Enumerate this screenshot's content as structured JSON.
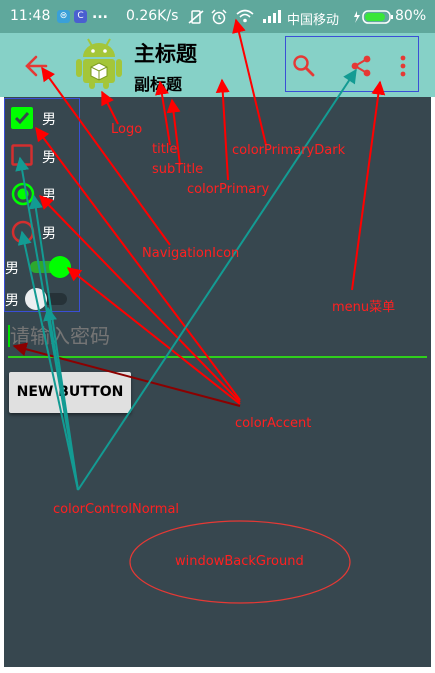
{
  "status_bar": {
    "time": "11:48",
    "overflow_dots": "...",
    "net_speed": "0.26K/s",
    "carrier": "中国移动",
    "battery": "80%"
  },
  "toolbar": {
    "title": "主标题",
    "subtitle": "副标题"
  },
  "widgets": {
    "checkbox_checked_label": "男",
    "checkbox_unchecked_label": "男",
    "radio_checked_label": "男",
    "radio_unchecked_label": "男",
    "switch_on_label": "男",
    "switch_off_label": "男",
    "checkbox_checked": true,
    "checkbox_unchecked": false,
    "radio_checked": true,
    "radio_unchecked": false,
    "switch_on": true,
    "switch_off": false
  },
  "edit_text": {
    "placeholder": "请输入密码",
    "value": ""
  },
  "button": {
    "label": "NEW BUTTON"
  },
  "annotations": {
    "logo": "Logo",
    "title": "title",
    "subtitle": "subTitle",
    "color_primary": "colorPrimary",
    "color_primary_dark": "colorPrimaryDark",
    "navigation_icon": "NavigationIcon",
    "menu": "menu菜单",
    "color_accent": "colorAccent",
    "color_control_normal": "colorControlNormal",
    "window_background": "windowBackGround"
  },
  "colors": {
    "color_primary": "#86d1c7",
    "color_primary_dark": "#5fa89c",
    "color_accent": "#00ff00",
    "color_control_normal": "#d32f2f",
    "window_background": "#37474f",
    "menu_icon": "#e53935",
    "annotation_text": "#ff2020",
    "arrow_red": "#ff0000",
    "arrow_teal": "#139b93",
    "arrow_darkred": "#8b0000"
  },
  "icons": {
    "navigation": "arrow-back-icon",
    "logo": "android-logo-icon",
    "search": "search-icon",
    "share": "share-icon",
    "overflow": "more-vert-icon"
  }
}
